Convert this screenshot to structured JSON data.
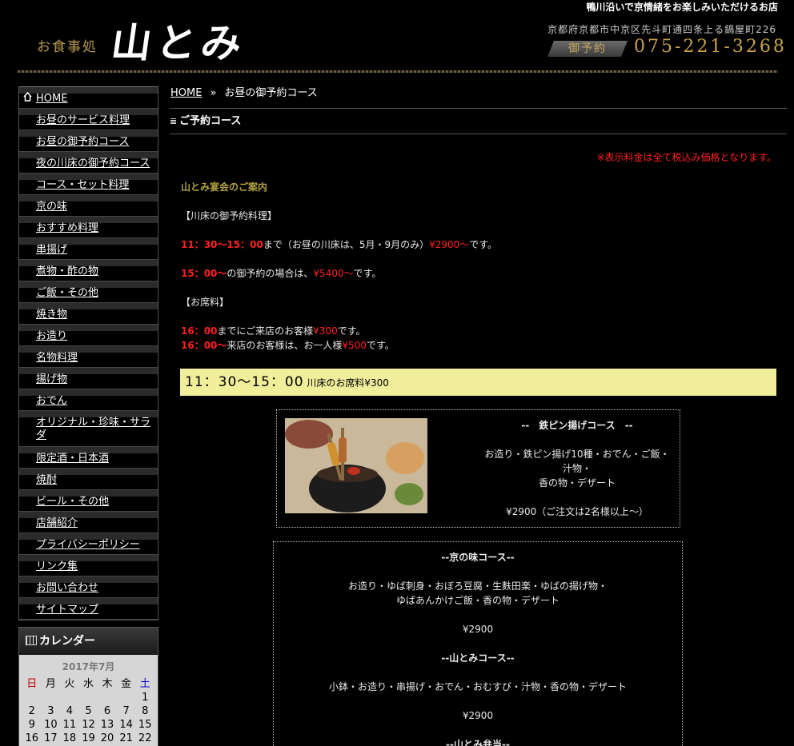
{
  "header": {
    "tagline": "鴨川沿いで京情緒をお楽しみいただけるお店",
    "logo_small": "お食事処",
    "logo_big": "山とみ",
    "address": "京都府京都市中京区先斗町通四条上る鍋屋町226",
    "reserve_badge": "御予約",
    "phone": "075-221-3268"
  },
  "sidebar": {
    "items": [
      {
        "label": "HOME"
      },
      {
        "label": "お昼のサービス料理"
      },
      {
        "label": "お昼の御予約コース"
      },
      {
        "label": "夜の川床の御予約コース"
      },
      {
        "label": "コース・セット料理"
      },
      {
        "label": "京の味"
      },
      {
        "label": "おすすめ料理"
      },
      {
        "label": "串揚げ"
      },
      {
        "label": "煮物・酢の物"
      },
      {
        "label": "ご飯・その他"
      },
      {
        "label": "焼き物"
      },
      {
        "label": "お造り"
      },
      {
        "label": "名物料理"
      },
      {
        "label": "揚げ物"
      },
      {
        "label": "おでん"
      },
      {
        "label": "オリジナル・珍味・サラダ"
      },
      {
        "label": "限定酒・日本酒"
      },
      {
        "label": "焼酎"
      },
      {
        "label": "ビール・その他"
      },
      {
        "label": "店舗紹介"
      },
      {
        "label": "プライバシーポリシー"
      },
      {
        "label": "リンク集"
      },
      {
        "label": "お問い合わせ"
      },
      {
        "label": "サイトマップ"
      }
    ],
    "calendar": {
      "title": "カレンダー",
      "month": "2017年7月",
      "weekdays": [
        "日",
        "月",
        "火",
        "水",
        "木",
        "金",
        "土"
      ],
      "days": [
        "",
        "",
        "",
        "",
        "",
        "",
        "1",
        "2",
        "3",
        "4",
        "5",
        "6",
        "7",
        "8",
        "9",
        "10",
        "11",
        "12",
        "13",
        "14",
        "15",
        "16",
        "17",
        "18",
        "19",
        "20",
        "21",
        "22"
      ]
    }
  },
  "breadcrumb": {
    "home": "HOME",
    "separator": "»",
    "current": "お昼の御予約コース"
  },
  "page_title": "ご予約コース",
  "notice": "※表示料金は全て税込み価格となります。",
  "content": {
    "heading": "山とみ宴会のご案内",
    "kawadoko": "【川床の御予約料理】",
    "line1_time": "11：30〜15：00",
    "line1_mid": "まで（お昼の川床は、5月・9月のみ）",
    "line1_price": "¥2900〜",
    "line1_end": "です。",
    "line2_time": "15：00〜",
    "line2_mid": "の御予約の場合は、",
    "line2_price": "¥5400〜",
    "line2_end": "です。",
    "seat_fee_label": "【お席料】",
    "line3_time": "16：00",
    "line3_mid": "までにご来店のお客様",
    "line3_price": "¥300",
    "line3_end": "です。",
    "line4_time": "16：00〜",
    "line4_mid": "来店のお客様は、お一人様",
    "line4_price": "¥500",
    "line4_end": "です。"
  },
  "banner": {
    "time": "11：30〜15：00",
    "text": "川床のお席料¥300"
  },
  "course1": {
    "title": "--　鉄ピン揚げコース　--",
    "desc1": "お造り・鉄ピン揚げ10種・おでん・ご飯・",
    "desc2": "汁物・",
    "desc3": "香の物・デザート",
    "price": "¥2900（ご注文は2名様以上〜）"
  },
  "course2": {
    "title": "--京の味コース--",
    "desc1": "お造り・ゆば刺身・おぼろ豆腐・生麩田楽・ゆばの揚げ物・",
    "desc2": "ゆばあんかけご飯・香の物・デザート",
    "price": "¥2900"
  },
  "course3": {
    "title": "--山とみコース--",
    "desc": "小鉢・お造り・串揚げ・おでん・おむすび・汁物・香の物・デザート",
    "price": "¥2900"
  },
  "course4": {
    "title": "--山とみ弁当--"
  }
}
